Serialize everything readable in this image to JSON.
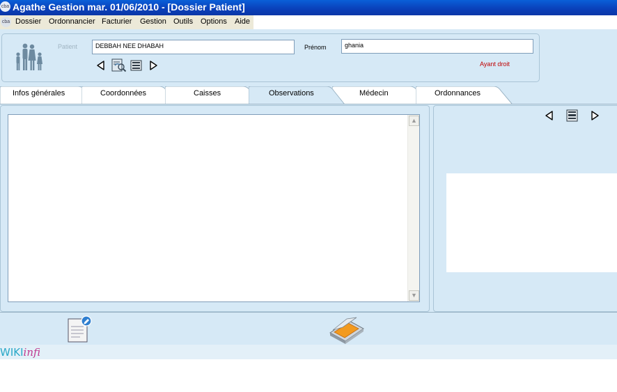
{
  "window": {
    "title": "Agathe Gestion mar. 01/06/2010 - [Dossier Patient]",
    "app_icon_text": "cba"
  },
  "menu": {
    "system_icon_text": "cba",
    "items": [
      "Dossier",
      "Ordonnancier",
      "Facturier",
      "Gestion",
      "Outils",
      "Options",
      "Aide"
    ]
  },
  "patient": {
    "patient_label": "Patient",
    "patient_value": "DEBBAH NEE DHABAH",
    "prenom_label": "Prénom",
    "prenom_value": "ghania",
    "ayant_droit_label": "Ayant droit"
  },
  "tabs": [
    {
      "label": "Infos générales",
      "active": false
    },
    {
      "label": "Coordonnées",
      "active": false
    },
    {
      "label": "Caisses",
      "active": false
    },
    {
      "label": "Observations",
      "active": true
    },
    {
      "label": "Médecin",
      "active": false
    },
    {
      "label": "Ordonnances",
      "active": false
    }
  ],
  "observations": {
    "text": ""
  },
  "logo": {
    "part1": "WIKI",
    "part2": "infi"
  },
  "colors": {
    "titlebar": "#0a3fb8",
    "panel_bg": "#d6e9f6",
    "active_tab": "#d6e9f6",
    "inactive_tab": "#ffffff",
    "ayant_droit": "#c00000",
    "logo_wiki": "#2aa8c8",
    "logo_infi": "#c0398f"
  },
  "icons": {
    "family": "family-icon",
    "prev": "prev-arrow-icon",
    "search": "patient-search-icon",
    "list": "patient-list-icon",
    "next": "next-arrow-icon",
    "document": "document-edit-icon",
    "scanner": "scanner-icon"
  }
}
